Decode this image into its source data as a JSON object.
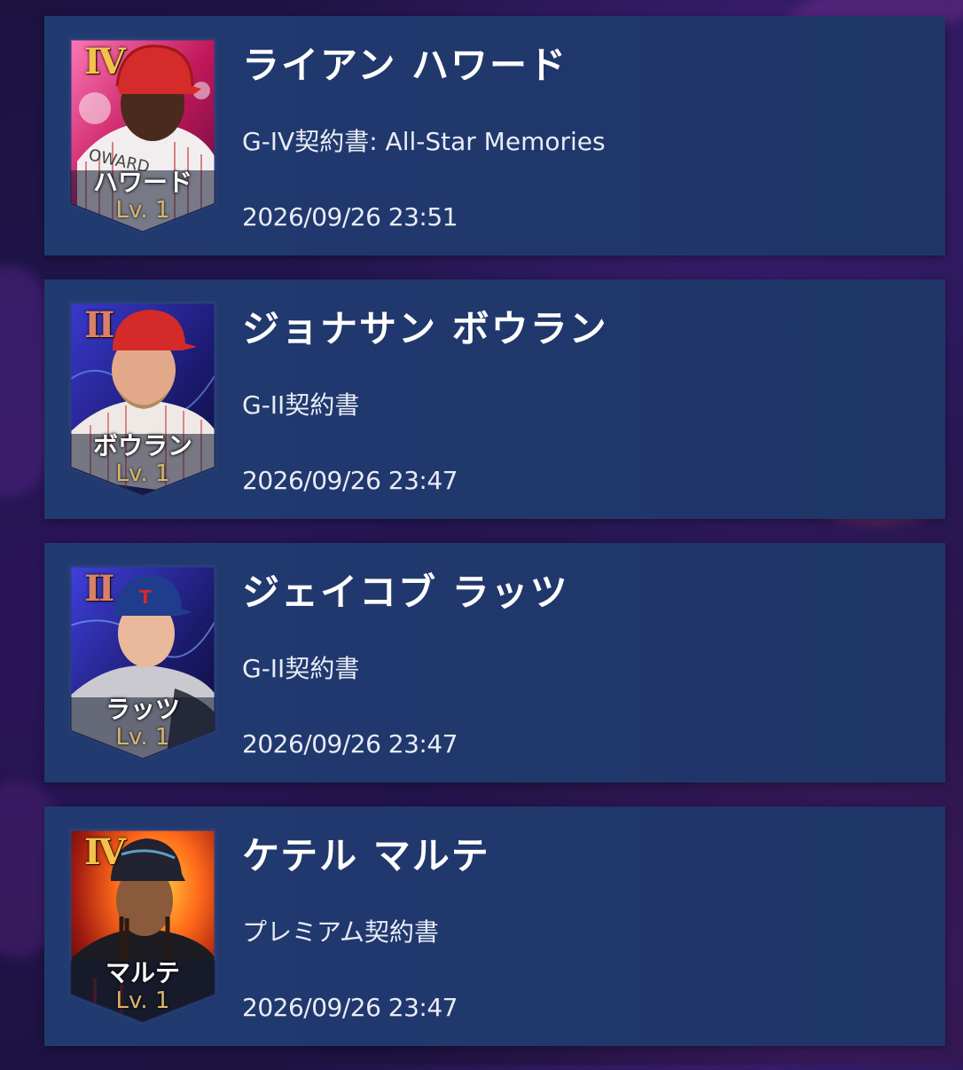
{
  "players": [
    {
      "name": "ライアン ハワード",
      "contract": "G-IV契約書: All-Star Memories",
      "date": "2026/09/26 23:51",
      "card": {
        "grade": "IV",
        "short_name": "ハワード",
        "level": "Lv. 1",
        "jersey_text": "OWARD"
      }
    },
    {
      "name": "ジョナサン ボウラン",
      "contract": "G-II契約書",
      "date": "2026/09/26 23:47",
      "card": {
        "grade": "II",
        "short_name": "ボウラン",
        "level": "Lv. 1"
      }
    },
    {
      "name": "ジェイコブ ラッツ",
      "contract": "G-II契約書",
      "date": "2026/09/26 23:47",
      "card": {
        "grade": "II",
        "short_name": "ラッツ",
        "level": "Lv. 1"
      }
    },
    {
      "name": "ケテル マルテ",
      "contract": "プレミアム契約書",
      "date": "2026/09/26 23:47",
      "card": {
        "grade": "IV",
        "short_name": "マルテ",
        "level": "Lv. 1"
      }
    }
  ],
  "colors": {
    "panel": "#213a70",
    "grade_gold": "#f4c24a",
    "grade_bronze": "#d9806a",
    "level_text": "#d8b56a"
  }
}
